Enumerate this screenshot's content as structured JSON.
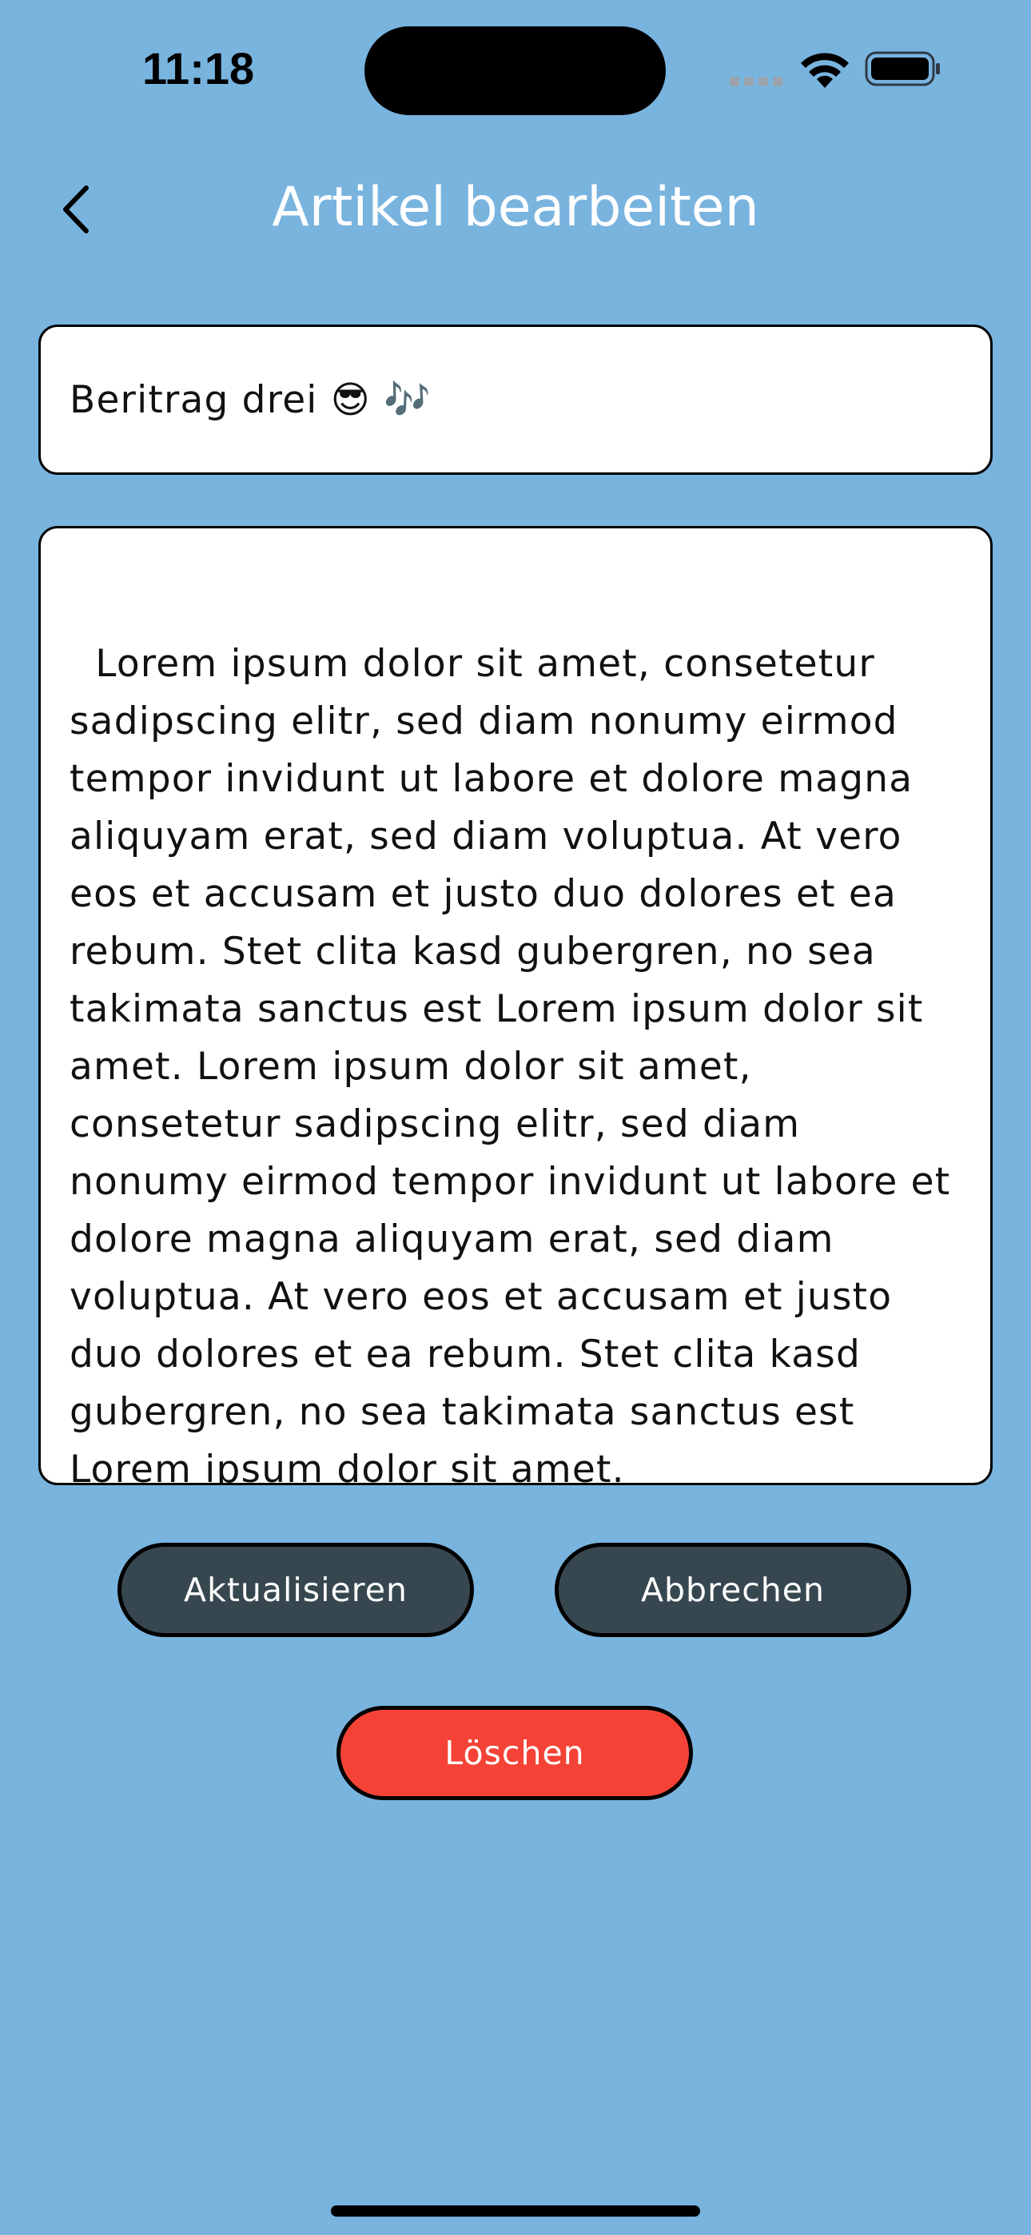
{
  "status_bar": {
    "time": "11:18",
    "signal_icon": "cellular-signal-icon",
    "wifi_icon": "wifi-icon",
    "battery_icon": "battery-icon"
  },
  "nav": {
    "back_icon": "chevron-left-icon",
    "title": "Artikel bearbeiten"
  },
  "form": {
    "title_value": "Beritrag drei 😎 🎶",
    "body_value": "Lorem ipsum dolor sit amet, consetetur sadipscing elitr, sed diam nonumy eirmod tempor invidunt ut labore et dolore magna aliquyam erat, sed diam voluptua. At vero eos et accusam et justo duo dolores et ea rebum. Stet clita kasd gubergren, no sea takimata sanctus est Lorem ipsum dolor sit amet. Lorem ipsum dolor sit amet, consetetur sadipscing elitr, sed diam nonumy eirmod tempor invidunt ut labore et dolore magna aliquyam erat, sed diam voluptua. At vero eos et accusam et justo duo dolores et ea rebum. Stet clita kasd gubergren, no sea takimata sanctus est Lorem ipsum dolor sit amet."
  },
  "actions": {
    "update_label": "Aktualisieren",
    "cancel_label": "Abbrechen",
    "delete_label": "Löschen"
  },
  "colors": {
    "background": "#79B4DF",
    "button_dark": "#37474F",
    "button_delete": "#F44336",
    "field_background": "#FFFFFF"
  }
}
